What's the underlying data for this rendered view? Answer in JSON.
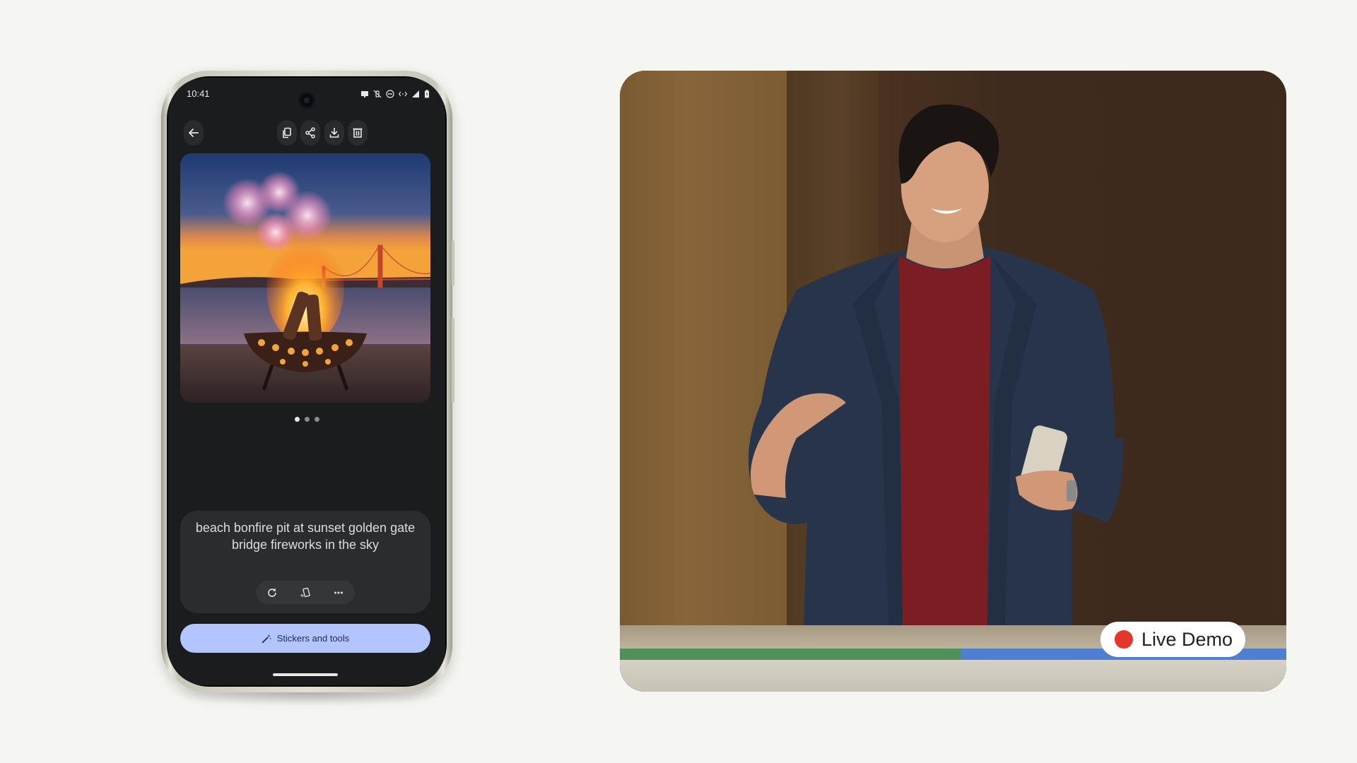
{
  "phone": {
    "status_bar": {
      "time": "10:41",
      "icons": [
        "cast-icon",
        "vibrate-off-icon",
        "do-not-disturb-icon",
        "data-saver-icon",
        "signal-icon",
        "battery-charging-icon"
      ]
    },
    "toolbar": {
      "back": "back-arrow-icon",
      "actions": [
        "copy-icon",
        "share-icon",
        "download-icon",
        "delete-icon"
      ]
    },
    "image": {
      "description": "AI generated image: beach bonfire pit at sunset with Golden Gate Bridge and fireworks"
    },
    "pager": {
      "count": 3,
      "active_index": 0
    },
    "prompt": {
      "text": "beach bonfire pit at sunset golden gate bridge fireworks in the sky",
      "actions": [
        "refresh-icon",
        "shake-phone-icon",
        "more-icon"
      ]
    },
    "stickers_button": {
      "label": "Stickers and tools",
      "icon": "magic-wand-icon"
    }
  },
  "video": {
    "badge_label": "Live Demo",
    "badge_dot_color": "#e3372c"
  },
  "colors": {
    "background": "#f5f5f1",
    "screen": "#1b1c1e",
    "card": "#2b2c2f",
    "accent_button": "#b2c5ff"
  }
}
